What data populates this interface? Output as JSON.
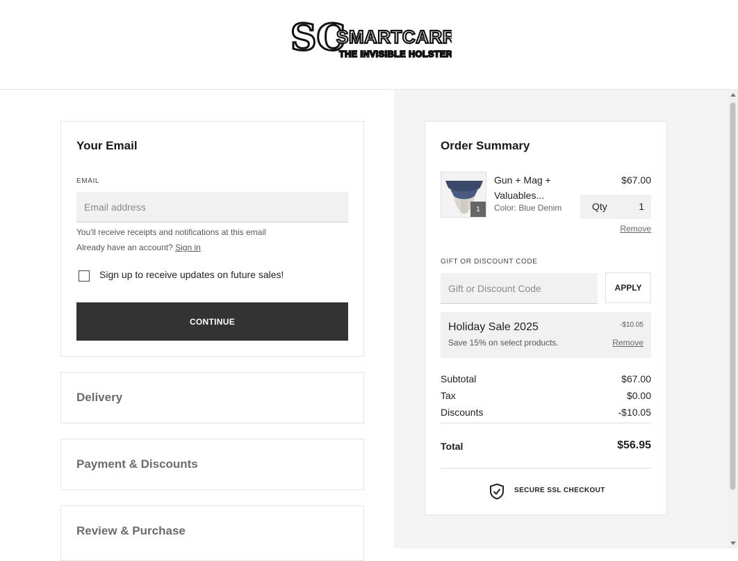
{
  "brand": {
    "logo_initials": "SC",
    "logo_name": "SMARTCARRY",
    "logo_tagline": "THE INVISIBLE HOLSTER"
  },
  "email_section": {
    "title": "Your Email",
    "field_label": "EMAIL",
    "placeholder": "Email address",
    "value": "",
    "helper_text": "You'll receive receipts and notifications at this email",
    "account_prompt": "Already have an account?",
    "sign_in_label": "Sign in",
    "newsletter_label": "Sign up to receive updates on future sales!",
    "newsletter_checked": false,
    "continue_label": "CONTINUE"
  },
  "steps": [
    {
      "label": "Delivery"
    },
    {
      "label": "Payment & Discounts"
    },
    {
      "label": "Review & Purchase"
    }
  ],
  "order_summary": {
    "title": "Order Summary",
    "item": {
      "name": "Gun + Mag + Valuables...",
      "color": "Color: Blue Denim",
      "price": "$67.00",
      "qty_label": "Qty",
      "qty": "1",
      "badge_count": "1",
      "remove_label": "Remove"
    },
    "discount": {
      "label": "GIFT OR DISCOUNT CODE",
      "placeholder": "Gift or Discount Code",
      "value": "",
      "apply_label": "APPLY"
    },
    "promo": {
      "name": "Holiday Sale 2025",
      "description": "Save 15% on select products.",
      "amount": "-$10.05",
      "remove_label": "Remove"
    },
    "totals": {
      "subtotal_label": "Subtotal",
      "subtotal": "$67.00",
      "tax_label": "Tax",
      "tax": "$0.00",
      "discounts_label": "Discounts",
      "discounts": "-$10.05",
      "total_label": "Total",
      "total": "$56.95"
    },
    "secure_label": "SECURE SSL CHECKOUT"
  },
  "colors": {
    "primary_button": "#333333",
    "right_panel_bg": "#f4f4f4",
    "input_bg": "#f1f1f1"
  }
}
